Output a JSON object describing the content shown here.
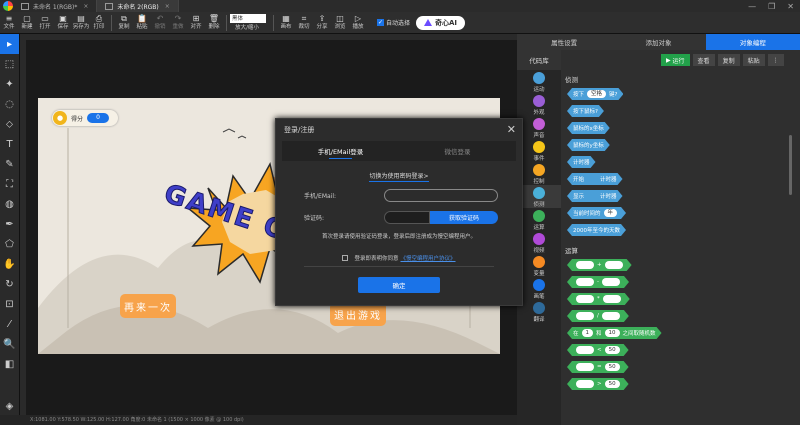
{
  "tabs": [
    {
      "label": "未命名 1(RGB)*",
      "active": false
    },
    {
      "label": "未命名 2(RGB)",
      "active": true
    }
  ],
  "toolbar": {
    "items": [
      {
        "label": "文件",
        "icon": "menu"
      },
      {
        "label": "新建",
        "icon": "new-file"
      },
      {
        "label": "打开",
        "icon": "open-folder"
      },
      {
        "label": "保存",
        "icon": "save"
      },
      {
        "label": "另存为",
        "icon": "save-as"
      },
      {
        "label": "打印",
        "icon": "print"
      },
      {
        "label": "复制",
        "icon": "copy"
      },
      {
        "label": "粘贴",
        "icon": "paste"
      },
      {
        "label": "撤销",
        "icon": "undo"
      },
      {
        "label": "重做",
        "icon": "redo"
      },
      {
        "label": "对齐",
        "icon": "align"
      },
      {
        "label": "删除",
        "icon": "delete"
      }
    ],
    "font": "黑体",
    "size_label": "放大/缩小",
    "right_items": [
      {
        "label": "画布",
        "icon": "canvas"
      },
      {
        "label": "裁切",
        "icon": "crop"
      },
      {
        "label": "分享",
        "icon": "share"
      },
      {
        "label": "浏览",
        "icon": "browse"
      },
      {
        "label": "播放",
        "icon": "play"
      }
    ],
    "auto_select": "自动选择",
    "ai_label": "奇心AI"
  },
  "stage": {
    "score_label": "得分",
    "score_value": "0",
    "title": "GAME O",
    "restart_label": "再来一次",
    "exit_label": "退出游戏"
  },
  "status_bar": "X:1081.00  Y:578.50  W:125.00  H:127.00  角度:0      未命名 1  (1500 × 1000 像素 @ 100 dpi)",
  "right_panel": {
    "tabs": [
      "属性设置",
      "添加对象",
      "对象编程"
    ],
    "active_tab": 2,
    "code_lib": "代码库",
    "categories": [
      {
        "label": "运动",
        "color": "#4a9fd8"
      },
      {
        "label": "外观",
        "color": "#9a5ed6"
      },
      {
        "label": "声音",
        "color": "#c25ed6"
      },
      {
        "label": "事件",
        "color": "#f5c518"
      },
      {
        "label": "控制",
        "color": "#f5a623"
      },
      {
        "label": "侦测",
        "color": "#4ab0d8"
      },
      {
        "label": "运算",
        "color": "#3cb05a"
      },
      {
        "label": "视频",
        "color": "#b04ad8"
      },
      {
        "label": "变量",
        "color": "#f58a23"
      },
      {
        "label": "画笔",
        "color": "#1a73e8"
      },
      {
        "label": "翻译",
        "color": "#2e6a9a"
      }
    ],
    "actions": {
      "run": "运行",
      "view": "查看",
      "copy": "复制",
      "paste": "粘贴"
    },
    "section_detect": "侦测",
    "detect_blocks": [
      {
        "text": "按下",
        "pill": "空格",
        "tail": "键?"
      },
      {
        "text": "按下鼠标?"
      },
      {
        "text": "鼠标的x坐标"
      },
      {
        "text": "鼠标的y坐标"
      },
      {
        "text": "计时器"
      },
      {
        "text": "开始",
        "tail": "计时器"
      },
      {
        "text": "显示",
        "tail": "计时器"
      },
      {
        "text": "当前时间的",
        "pill": "年"
      },
      {
        "text": "2000年至今的天数"
      }
    ],
    "section_ops": "运算",
    "op_blocks": [
      {
        "op": "+"
      },
      {
        "op": "-"
      },
      {
        "op": "*"
      },
      {
        "op": "/"
      },
      {
        "text": "在",
        "a": "1",
        "mid": "和",
        "b": "10",
        "tail": "之间取随机数"
      },
      {
        "op": "<",
        "b": "50"
      },
      {
        "op": "=",
        "b": "50"
      },
      {
        "op": ">",
        "b": "50"
      }
    ]
  },
  "dialog": {
    "title": "登录/注册",
    "tabs": [
      "手机/EMail登录",
      "微信登录"
    ],
    "switch_link": "切换为使用密码登录>",
    "phone_label": "手机/EMail:",
    "phone_value": "",
    "code_label": "验证码:",
    "code_button": "获取验证码",
    "note": "首次登录请使用验证码登录，登录后即注册成为慢空编程用户。",
    "agree_text": "登录即表明你同意",
    "agree_link": "《慢空编程用户协议》",
    "confirm": "确定"
  }
}
